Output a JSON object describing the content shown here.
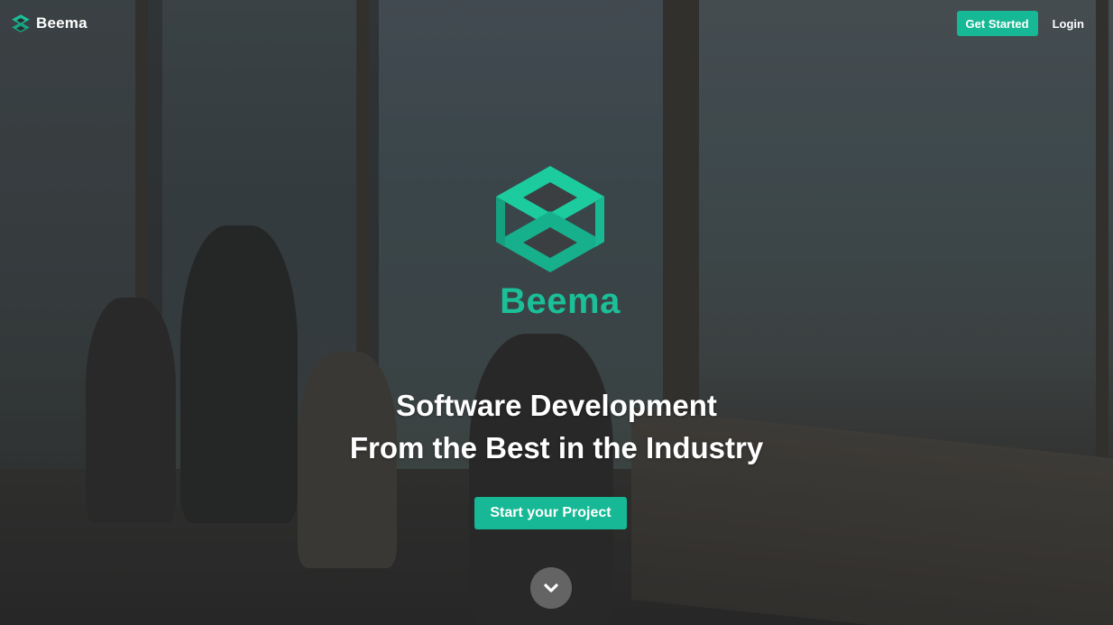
{
  "brand": {
    "name": "Beema",
    "logo_icon": "beema-logo-icon",
    "accent_color": "#17b895"
  },
  "nav": {
    "get_started_label": "Get Started",
    "login_label": "Login"
  },
  "hero": {
    "logo_name": "Beema",
    "headline_line1": "Software Development",
    "headline_line2": "From the Best in the Industry",
    "cta_label": "Start your Project",
    "scroll_icon": "chevron-down-icon"
  }
}
